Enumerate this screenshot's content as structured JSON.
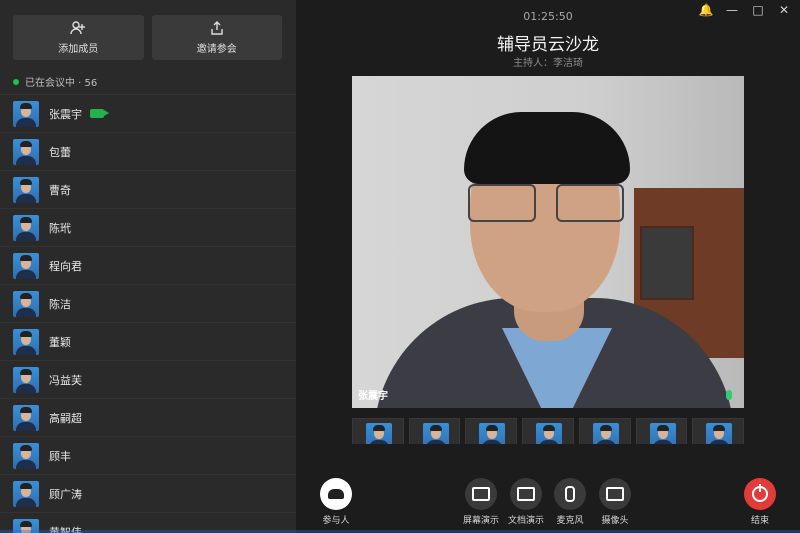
{
  "header": {
    "time": "01:25:50",
    "meeting_title": "辅导员云沙龙",
    "host_label": "主持人：李洁琦"
  },
  "sidebar": {
    "actions": [
      {
        "label": "添加成员",
        "icon": "add-user-icon"
      },
      {
        "label": "邀请参会",
        "icon": "share-icon"
      }
    ],
    "status": "已在会议中 · 56",
    "participants": [
      {
        "name": "张震宇",
        "camera_on": true
      },
      {
        "name": "包蕾"
      },
      {
        "name": "曹奇"
      },
      {
        "name": "陈玳"
      },
      {
        "name": "程向君"
      },
      {
        "name": "陈洁"
      },
      {
        "name": "董颖"
      },
      {
        "name": "冯益芙"
      },
      {
        "name": "高嗣超"
      },
      {
        "name": "顾丰"
      },
      {
        "name": "顾广涛"
      },
      {
        "name": "黄智伟"
      }
    ]
  },
  "video": {
    "speaker_name": "张震宇"
  },
  "controls": {
    "participants": "参与人",
    "screen_share": "屏幕演示",
    "doc_share": "文档演示",
    "microphone": "麦克风",
    "camera": "摄像头",
    "end": "结束"
  },
  "colors": {
    "accent_green": "#23b14d",
    "end_red": "#e23b3b"
  }
}
